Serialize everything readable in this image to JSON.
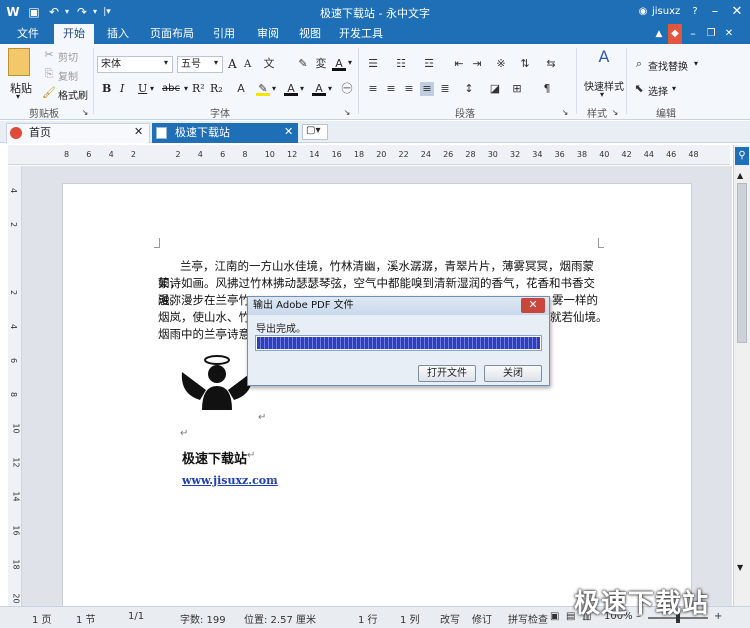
{
  "app": {
    "title": "极速下载站 - 永中文字",
    "user": "jisuxz"
  },
  "ribbon_tabs": [
    "文件",
    "开始",
    "插入",
    "页面布局",
    "引用",
    "审阅",
    "视图",
    "开发工具"
  ],
  "ribbon": {
    "clipboard": {
      "paste": "粘贴",
      "cut": "剪切",
      "copy": "复制",
      "format_painter": "格式刷",
      "group": "剪贴板"
    },
    "font": {
      "name": "宋体",
      "size": "五号",
      "group": "字体",
      "bold": "B",
      "italic": "I",
      "underline": "U",
      "strike": "abc",
      "super": "R²",
      "sub": "R₂",
      "grow": "A",
      "shrink": "A"
    },
    "paragraph": {
      "group": "段落"
    },
    "style": {
      "quick": "快速样式",
      "group": "样式"
    },
    "edit": {
      "find": "查找替换",
      "select": "选择",
      "group": "编辑"
    }
  },
  "doc_tabs": [
    "首页",
    "极速下载站"
  ],
  "ruler": {
    "h": [
      "8",
      "6",
      "4",
      "2",
      "",
      "2",
      "4",
      "6",
      "8",
      "10",
      "12",
      "14",
      "16",
      "18",
      "20",
      "22",
      "24",
      "26",
      "28",
      "30",
      "32",
      "34",
      "36",
      "38",
      "40",
      "42",
      "44",
      "46",
      "48"
    ],
    "v": [
      "4",
      "2",
      "",
      "2",
      "4",
      "6",
      "8",
      "10",
      "12",
      "14",
      "16",
      "18",
      "20"
    ]
  },
  "document": {
    "lines": [
      "兰亭，江南的一方山水佳境，竹林清幽，溪水潺潺，青翠片片，薄雾冥冥，烟雨蒙蒙，",
      "如诗如画。风拂过竹林拂动瑟瑟琴弦，空气中都能嗅到清新湿润的香气，花香和书香交融弥",
      "漫。漫步在兰亭竹",
      "烟岚，使山水、竹林",
      "烟雨中的兰亭诗意"
    ],
    "line3_tail": "雾一样的",
    "line4_tail": "就若仙境。",
    "heading": "极速下载站",
    "url": "www.jisuxz.com"
  },
  "dialog": {
    "title": "输出 Adobe PDF 文件",
    "message": "导出完成。",
    "progress": 1.0,
    "open_button": "打开文件",
    "close_button": "关闭"
  },
  "status": {
    "page": "1 页",
    "section": "1 节",
    "pages": "1/1",
    "words": "字数: 199",
    "position": "位置: 2.57 厘米",
    "line": "1 行",
    "col": "1 列",
    "overtype": "改写",
    "revise": "修订",
    "spell": "拼写检查",
    "zoom": "100%"
  },
  "watermark": "极速下载站",
  "colors": {
    "accent": "#1e6fb5",
    "progress": "#2f3fb7"
  }
}
